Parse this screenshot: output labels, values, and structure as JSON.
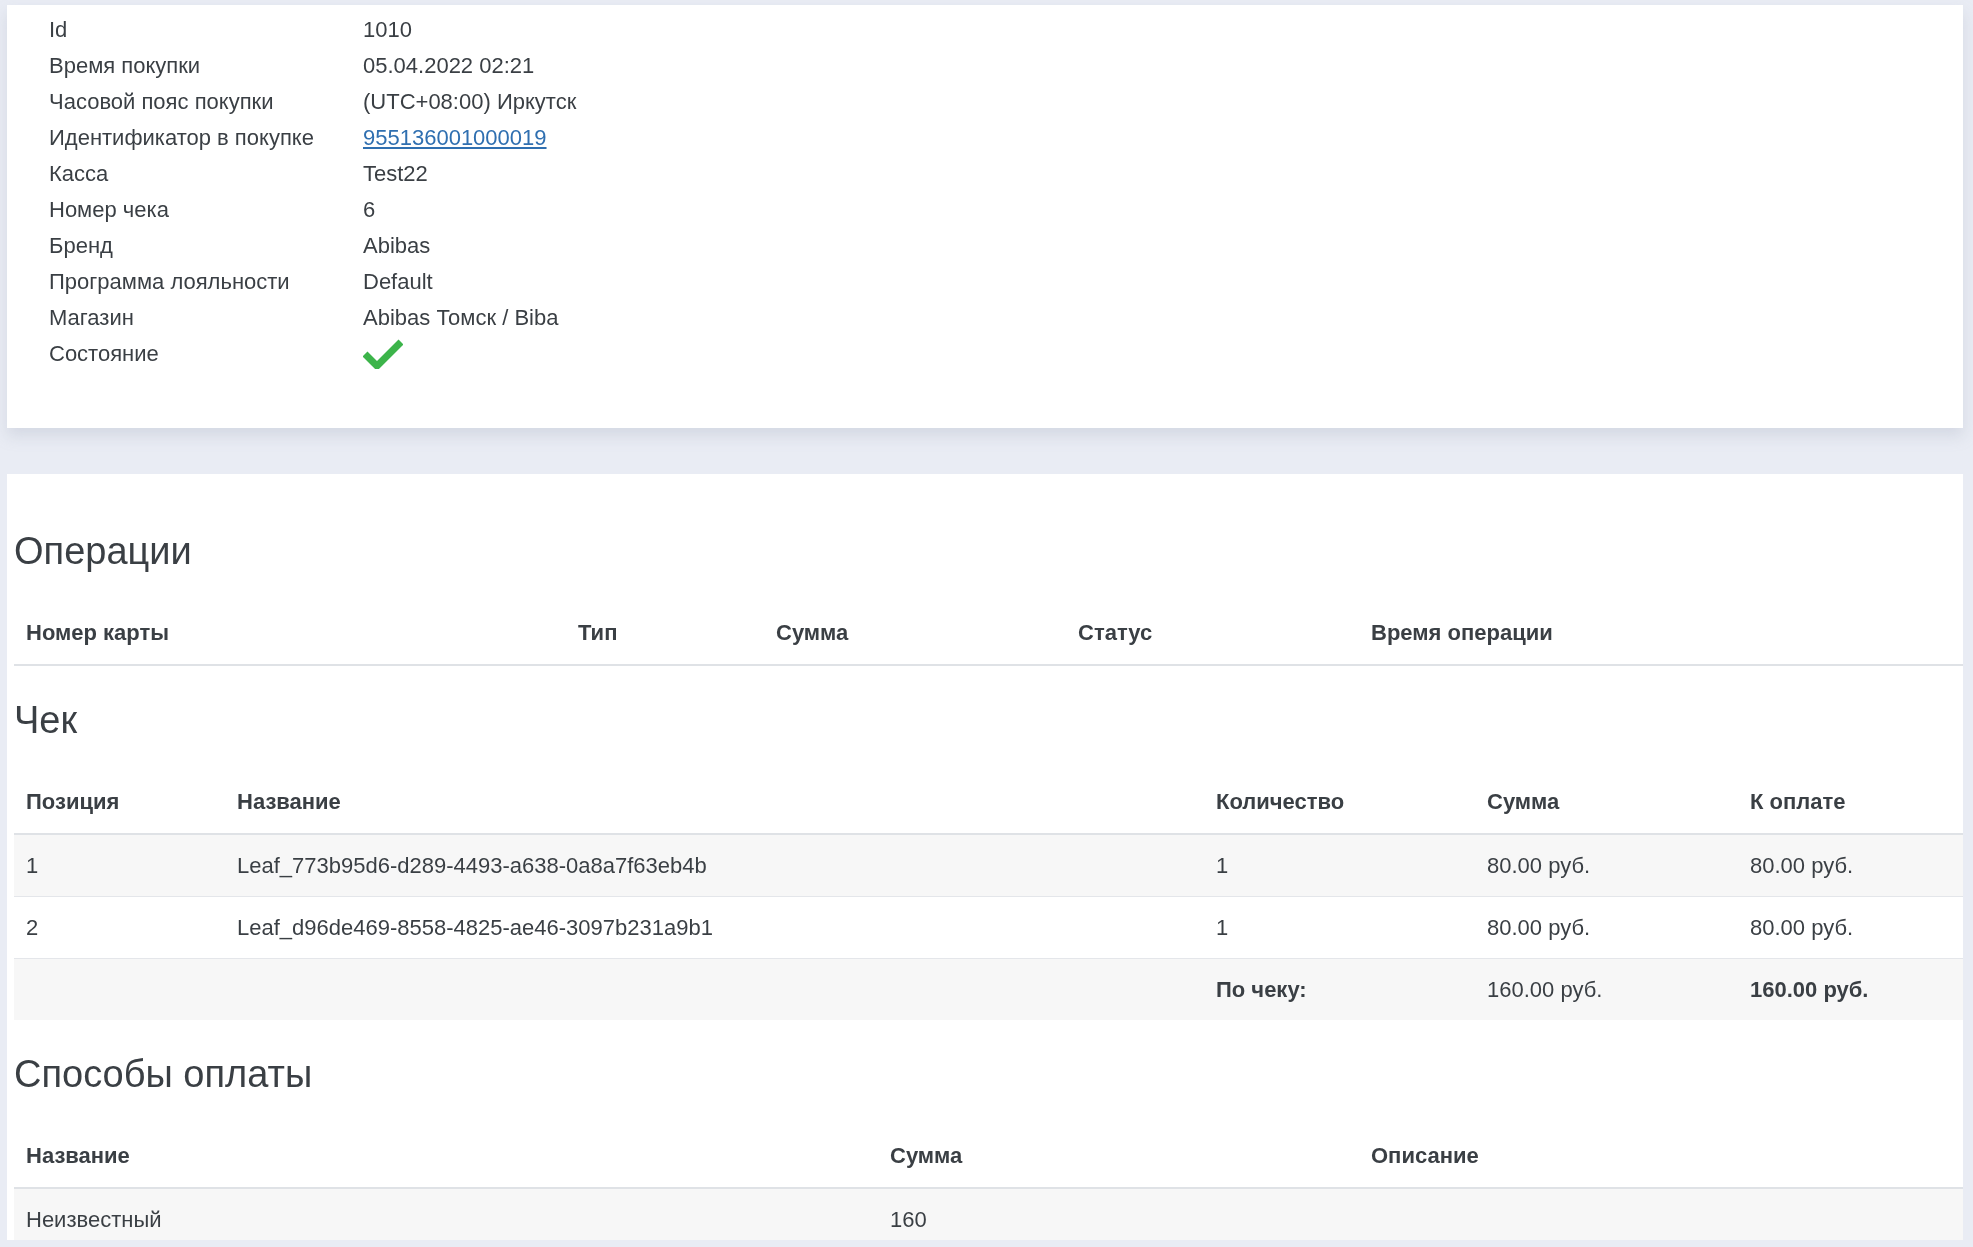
{
  "details": [
    {
      "label": "Id",
      "kind": "text",
      "value": "1010"
    },
    {
      "label": "Время покупки",
      "kind": "text",
      "value": "05.04.2022 02:21"
    },
    {
      "label": "Часовой пояс покупки",
      "kind": "text",
      "value": "(UTC+08:00) Иркутск"
    },
    {
      "label": "Идентификатор в покупке",
      "kind": "link",
      "value": "955136001000019"
    },
    {
      "label": "Касса",
      "kind": "text",
      "value": "Test22"
    },
    {
      "label": "Номер чека",
      "kind": "text",
      "value": "6"
    },
    {
      "label": "Бренд",
      "kind": "text",
      "value": "Abibas"
    },
    {
      "label": "Программа лояльности",
      "kind": "text",
      "value": "Default"
    },
    {
      "label": "Магазин",
      "kind": "text",
      "value": "Abibas Томск / Biba"
    },
    {
      "label": "Состояние",
      "kind": "status",
      "ok": true
    }
  ],
  "operations": {
    "title": "Операции",
    "columns": [
      "Номер карты",
      "Тип",
      "Сумма",
      "Статус",
      "Время операции"
    ]
  },
  "receipt": {
    "title": "Чек",
    "columns": [
      "Позиция",
      "Название",
      "Количество",
      "Сумма",
      "К оплате"
    ],
    "rows": [
      [
        "1",
        "Leaf_773b95d6-d289-4493-a638-0a8a7f63eb4b",
        "1",
        "80.00 руб.",
        "80.00 руб."
      ],
      [
        "2",
        "Leaf_d96de469-8558-4825-ae46-3097b231a9b1",
        "1",
        "80.00 руб.",
        "80.00 руб."
      ]
    ],
    "total": {
      "label": "По чеку:",
      "sum": "160.00 руб.",
      "payable": "160.00 руб."
    }
  },
  "payments": {
    "title": "Способы оплаты",
    "columns": [
      "Название",
      "Сумма",
      "Описание"
    ],
    "rows": [
      [
        "Неизвестный",
        "160",
        ""
      ]
    ]
  }
}
